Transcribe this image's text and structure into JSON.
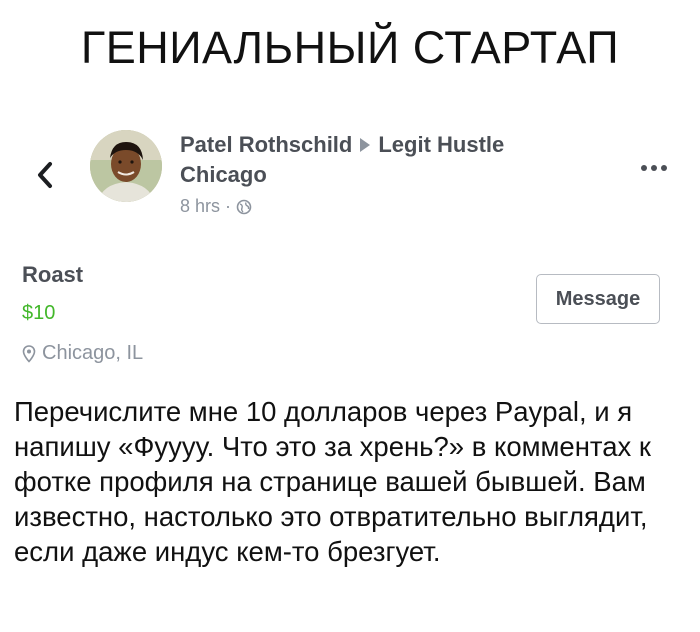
{
  "meme": {
    "title": "ГЕНИАЛЬНЫЙ СТАРТАП",
    "caption": "Перечислите мне 10 долларов через Paypal, и я напишу «Фуууу. Что это за хрень?» в комментах к фотке профиля на странице вашей бывшей. Вам известно, настолько это отвратительно выглядит, если даже индус кем-то брезгует."
  },
  "post": {
    "author": "Patel Rothschild",
    "group": "Legit Hustle",
    "location": "Chicago",
    "time": "8 hrs",
    "separator": "·",
    "icons": {
      "back": "chevron-left-icon",
      "audience": "globe-icon",
      "more": "more-dots-icon",
      "arrow": "triangle-right-icon",
      "pin": "location-pin-icon"
    }
  },
  "listing": {
    "name": "Roast",
    "price": "$10",
    "location": "Chicago, IL",
    "message_label": "Message"
  },
  "colors": {
    "price_green": "#42b72a",
    "secondary_gray": "#8d949e",
    "name_gray": "#4b4f56"
  }
}
